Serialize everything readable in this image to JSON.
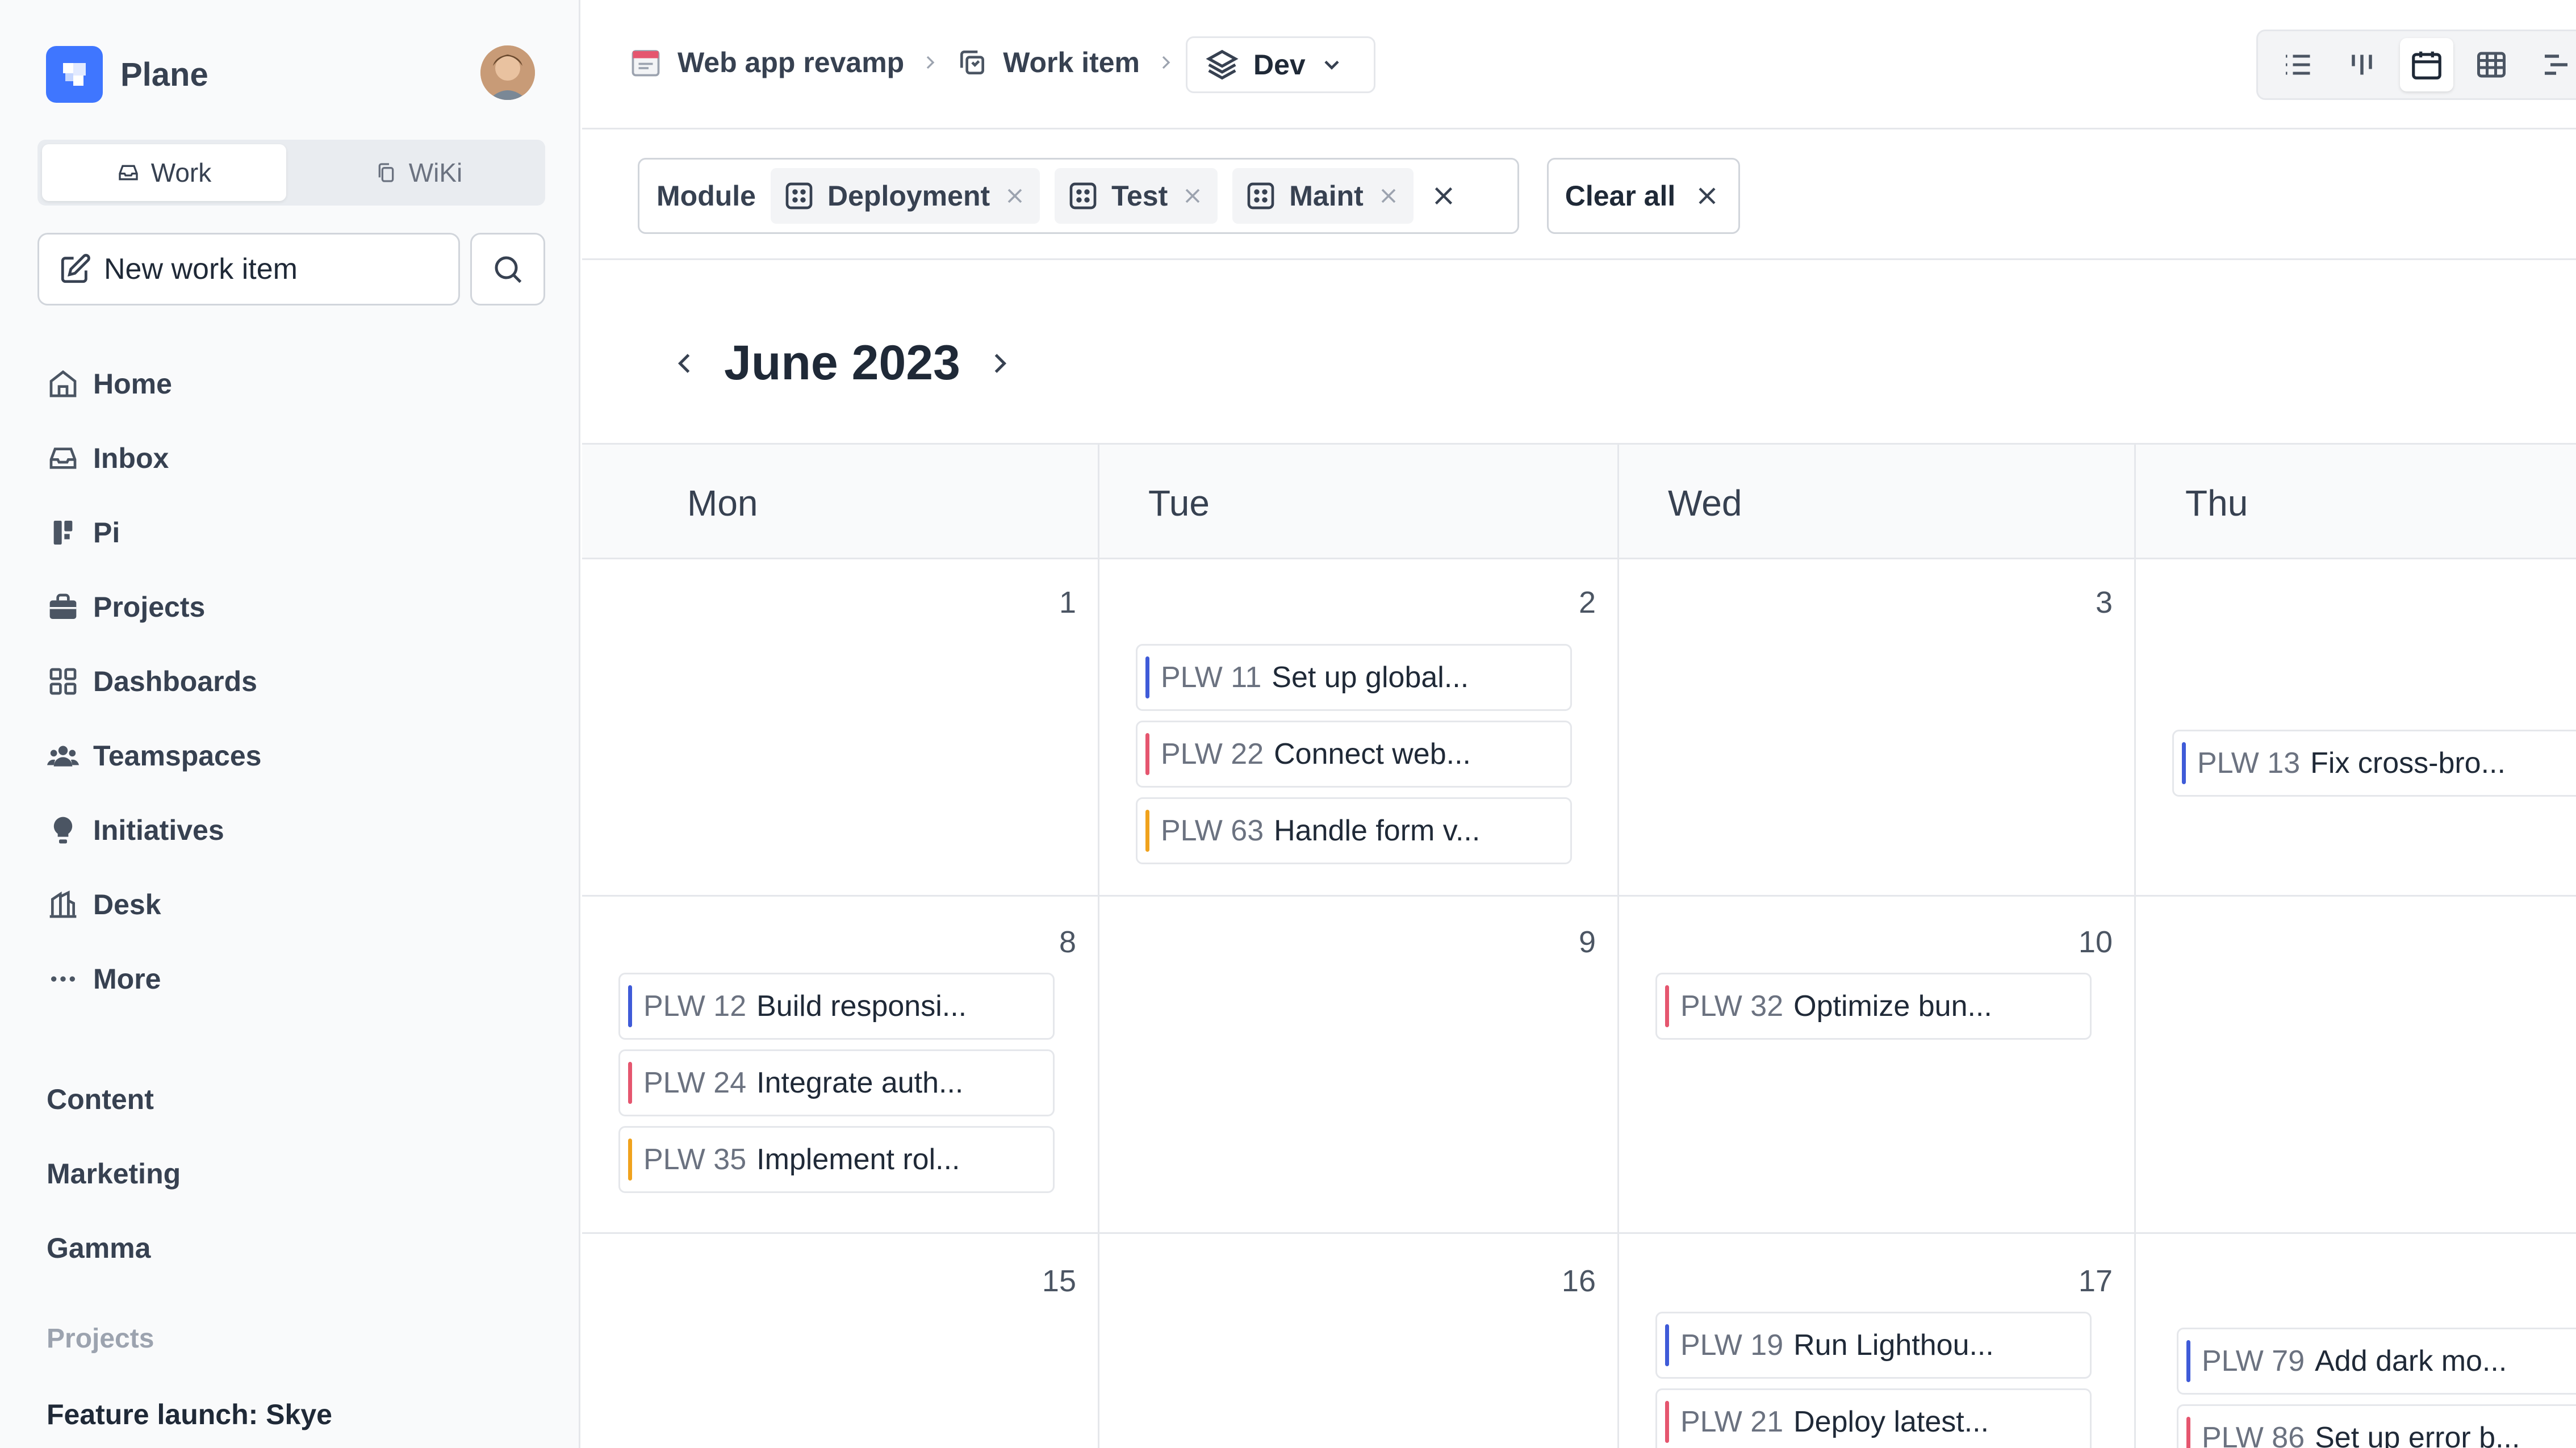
{
  "app": {
    "name": "Plane"
  },
  "sidebar": {
    "tabs": [
      {
        "label": "Work",
        "icon": "inbox-tray-icon"
      },
      {
        "label": "WiKi",
        "icon": "copy-icon"
      }
    ],
    "new_work_item": "New work item",
    "nav": [
      {
        "label": "Home",
        "icon": "home-icon"
      },
      {
        "label": "Inbox",
        "icon": "inbox-icon"
      },
      {
        "label": "Pi",
        "icon": "pi-icon"
      },
      {
        "label": "Projects",
        "icon": "briefcase-icon"
      },
      {
        "label": "Dashboards",
        "icon": "dashboard-grid-icon"
      },
      {
        "label": "Teamspaces",
        "icon": "team-icon"
      },
      {
        "label": "Initiatives",
        "icon": "lightbulb-icon"
      },
      {
        "label": "Desk",
        "icon": "desk-icon"
      },
      {
        "label": "More",
        "icon": "more-dots-icon"
      }
    ],
    "workspaces": [
      "Content",
      "Marketing",
      "Gamma"
    ],
    "projects_section": "Projects",
    "projects": [
      "Feature launch: Skye"
    ]
  },
  "header": {
    "breadcrumbs": [
      "Web app revamp",
      "Work item"
    ],
    "view": "Dev"
  },
  "filters": {
    "label": "Module",
    "chips": [
      "Deployment",
      "Test",
      "Maint"
    ],
    "clear_all": "Clear all"
  },
  "calendar": {
    "month": "June 2023",
    "days": [
      "Mon",
      "Tue",
      "Wed",
      "Thu"
    ],
    "weeks": [
      {
        "dates": [
          "1",
          "2",
          "3",
          ""
        ]
      },
      {
        "dates": [
          "8",
          "9",
          "10",
          ""
        ]
      },
      {
        "dates": [
          "15",
          "16",
          "17",
          ""
        ]
      }
    ],
    "items": [
      {
        "id": "PLW 11",
        "title": "Set up global...",
        "color": "#3f5bd8"
      },
      {
        "id": "PLW 22",
        "title": "Connect web...",
        "color": "#e5566f"
      },
      {
        "id": "PLW 63",
        "title": "Handle form v...",
        "color": "#f0a21d"
      },
      {
        "id": "PLW 13",
        "title": "Fix cross-bro...",
        "color": "#3f5bd8"
      },
      {
        "id": "PLW 12",
        "title": "Build responsi...",
        "color": "#3f5bd8"
      },
      {
        "id": "PLW 24",
        "title": "Integrate auth...",
        "color": "#e5566f"
      },
      {
        "id": "PLW 35",
        "title": "Implement rol...",
        "color": "#f0a21d"
      },
      {
        "id": "PLW 32",
        "title": "Optimize bun...",
        "color": "#e5566f"
      },
      {
        "id": "PLW 19",
        "title": "Run Lighthou...",
        "color": "#3f5bd8"
      },
      {
        "id": "PLW 21",
        "title": "Deploy latest...",
        "color": "#e5566f"
      },
      {
        "id": "PLW 79",
        "title": "Add dark mo...",
        "color": "#3f5bd8"
      },
      {
        "id": "PLW 86",
        "title": "Set up error b...",
        "color": "#e5566f"
      }
    ]
  },
  "colors": {
    "accent": "#3f76ff",
    "sidebar_bg": "#f9fafb",
    "border": "#e5e7eb"
  }
}
